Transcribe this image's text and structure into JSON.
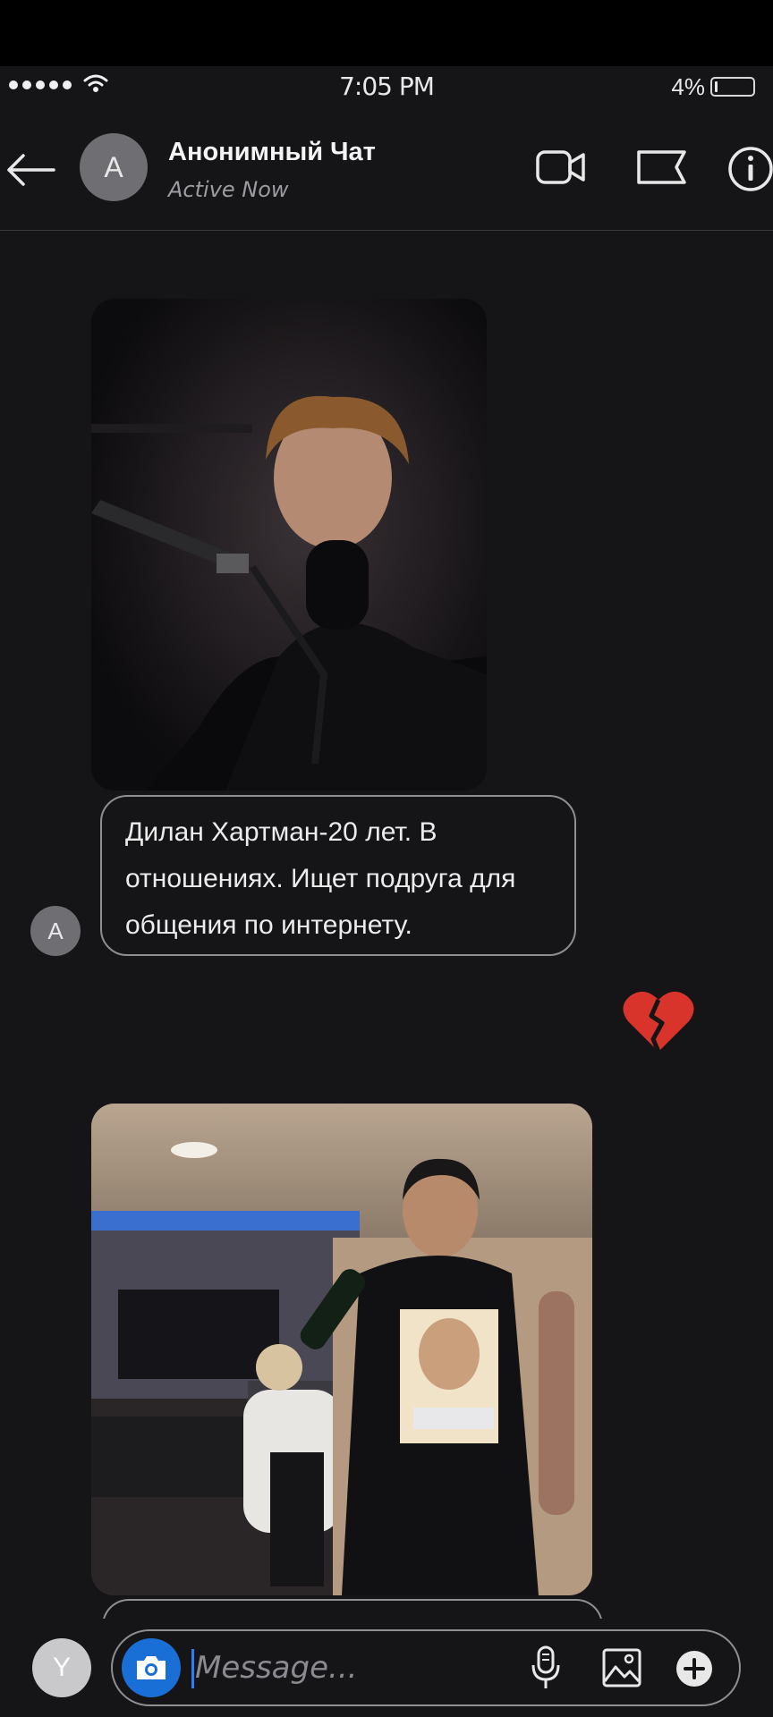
{
  "status_bar": {
    "time": "7:05 PM",
    "battery": "4%"
  },
  "header": {
    "avatar_letter": "A",
    "title": "Анонимный Чат",
    "status": "Active Now"
  },
  "messages": {
    "text_1": "Дилан Хартман-20 лет. В отношениях. Ищет подруга для общения по интернету.",
    "sender_avatar_letter": "A",
    "reaction": "💔"
  },
  "composer": {
    "avatar_letter": "Y",
    "placeholder": "Message..."
  },
  "colors": {
    "background": "#151417",
    "bubble_border": "#8f8e93",
    "camera_button": "#1a6fd6",
    "avatar": "#6f6e73"
  },
  "icons": {
    "back": "arrow-left-icon",
    "video": "video-camera-icon",
    "flag": "flag-icon",
    "info": "info-icon",
    "camera": "camera-icon",
    "mic": "microphone-icon",
    "gallery": "image-icon",
    "add": "plus-icon"
  }
}
